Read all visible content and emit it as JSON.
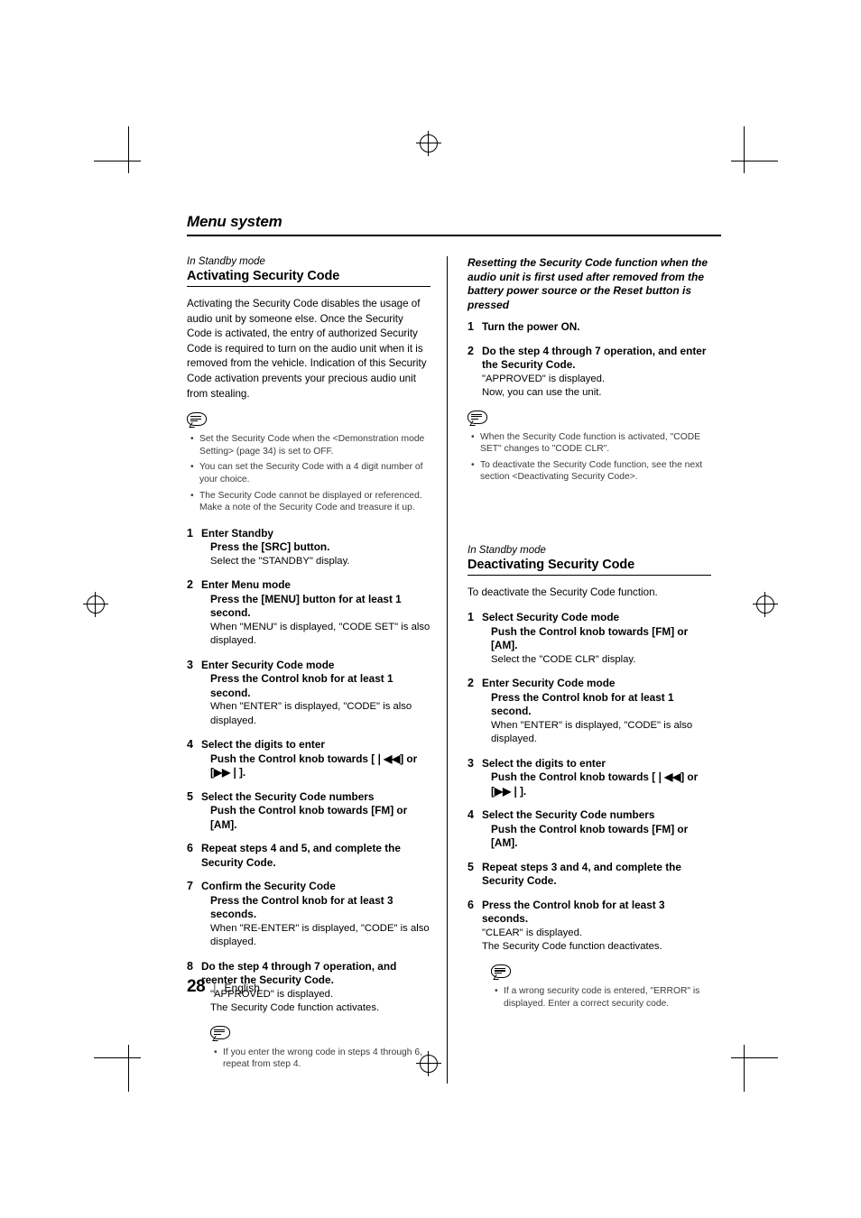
{
  "document": {
    "title": "Menu system",
    "page_number": "28",
    "language": "English",
    "footer_separator": "|"
  },
  "left_column": {
    "standby_label": "In Standby mode",
    "heading": "Activating Security Code",
    "intro": "Activating the Security Code disables the usage of audio unit by someone else. Once the Security Code is activated, the entry of authorized Security Code is required to turn on the audio unit when it is removed from the vehicle. Indication of this Security Code activation prevents  your precious audio unit from stealing.",
    "notes": [
      "Set the Security Code when the <Demonstration mode Setting> (page 34) is set to OFF.",
      "You can set the Security Code with a 4 digit number of your choice.",
      "The Security Code cannot be displayed or referenced. Make a note of the Security Code and treasure it up."
    ],
    "steps": [
      {
        "num": "1",
        "title": "Enter Standby",
        "bold_detail": "Press the [SRC] button.",
        "detail": "Select the \"STANDBY\" display."
      },
      {
        "num": "2",
        "title": "Enter Menu mode",
        "bold_detail": "Press the [MENU] button for at least 1 second.",
        "detail": "When \"MENU\" is displayed, \"CODE SET\" is also displayed."
      },
      {
        "num": "3",
        "title": "Enter Security Code mode",
        "bold_detail": "Press the Control knob for at least 1 second.",
        "detail": "When \"ENTER\" is displayed, \"CODE\" is also displayed."
      },
      {
        "num": "4",
        "title": "Select the digits to enter",
        "bold_detail": "Push the Control knob towards [❘◀◀] or [▶▶❘].",
        "detail": ""
      },
      {
        "num": "5",
        "title": "Select the Security Code numbers",
        "bold_detail": "Push the Control knob towards [FM] or [AM].",
        "detail": ""
      },
      {
        "num": "6",
        "title": "Repeat steps 4 and 5, and complete the Security Code.",
        "bold_detail": "",
        "detail": ""
      },
      {
        "num": "7",
        "title": "Confirm the Security Code",
        "bold_detail": "Press the Control knob for at least 3 seconds.",
        "detail": "When \"RE-ENTER\" is displayed, \"CODE\" is also displayed."
      },
      {
        "num": "8",
        "title": "Do the step 4 through 7 operation, and reenter the Security Code.",
        "bold_detail": "",
        "detail": "\"APPROVED\" is displayed.\nThe Security Code function activates."
      }
    ],
    "final_note": "If you enter the wrong code in steps 4 through 6, repeat from step 4."
  },
  "right_column": {
    "reset_heading": "Resetting the Security Code function when the audio unit is first used after removed from the battery power source or the Reset button is pressed",
    "reset_steps": [
      {
        "num": "1",
        "title": "Turn the power ON.",
        "detail": ""
      },
      {
        "num": "2",
        "title": "Do the step 4 through 7 operation, and enter the Security Code.",
        "detail": "\"APPROVED\" is displayed.\nNow, you can use the unit."
      }
    ],
    "reset_notes": [
      "When the Security Code function is activated, \"CODE SET\" changes to \"CODE CLR\".",
      "To deactivate the Security Code function, see the next section <Deactivating Security Code>."
    ],
    "standby_label": "In Standby mode",
    "heading": "Deactivating Security Code",
    "intro": "To deactivate the Security Code function.",
    "steps": [
      {
        "num": "1",
        "title": "Select Security Code mode",
        "bold_detail": "Push the Control knob towards [FM] or [AM].",
        "detail": "Select the \"CODE CLR\" display."
      },
      {
        "num": "2",
        "title": "Enter Security Code mode",
        "bold_detail": "Press the Control knob for at least 1 second.",
        "detail": "When \"ENTER\" is displayed, \"CODE\" is also displayed."
      },
      {
        "num": "3",
        "title": "Select the digits to enter",
        "bold_detail": "Push the Control knob towards [❘◀◀] or [▶▶❘].",
        "detail": ""
      },
      {
        "num": "4",
        "title": "Select the Security Code numbers",
        "bold_detail": "Push the Control knob towards [FM] or [AM].",
        "detail": ""
      },
      {
        "num": "5",
        "title": "Repeat steps 3 and 4, and complete the Security Code.",
        "bold_detail": "",
        "detail": ""
      },
      {
        "num": "6",
        "title": "Press the Control knob for at least 3 seconds.",
        "bold_detail": "",
        "detail": "\"CLEAR\" is displayed.\nThe Security Code function deactivates."
      }
    ],
    "final_note": "If a wrong security code is entered, \"ERROR\" is displayed. Enter a correct security code."
  },
  "icons": {
    "note_bubble": "note-bubble-icon"
  }
}
